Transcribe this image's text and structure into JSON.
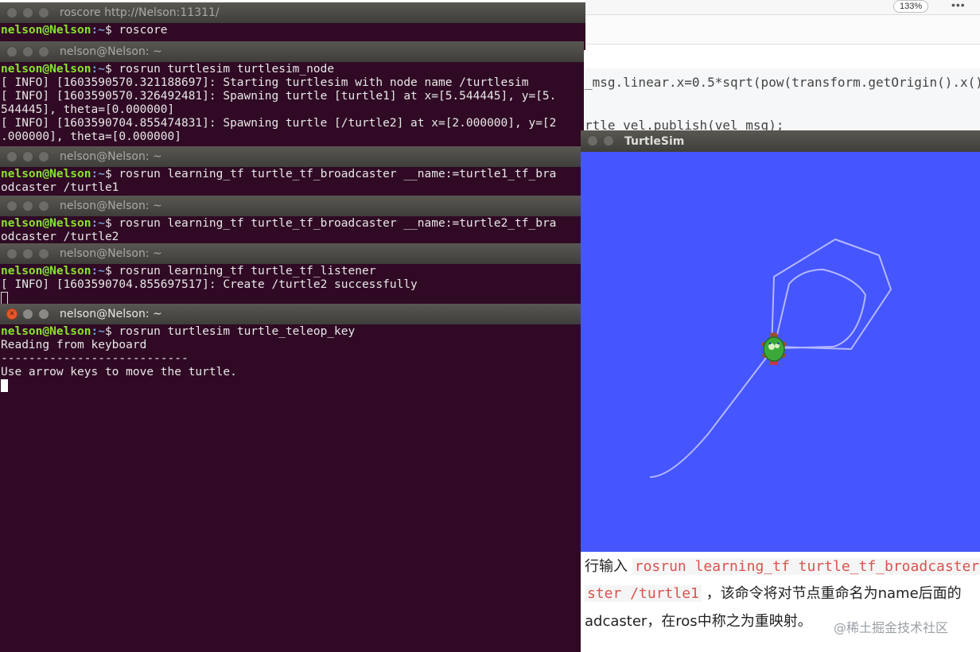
{
  "browser": {
    "zoom": "133%",
    "menu": "•••"
  },
  "code_snippet": {
    "line1": "_msg.linear.x=0.5*sqrt(pow(transform.getOrigin().x()",
    "line2": "rtle_vel.publish(vel_msg);"
  },
  "article": {
    "line1_prefix": "行输入",
    "line1_code": "rosrun learning_tf turtle_tf_broadcaster",
    "line2_code": "ster /turtle1",
    "line2_suffix": "，该命令将对节点重命名为name后面的",
    "line3": "adcaster，在ros中称之为重映射。",
    "watermark": "@稀土掘金技术社区"
  },
  "prompt": {
    "user": "nelson@Nelson",
    "path": ":~",
    "symbol": "$"
  },
  "terminals": [
    {
      "title": "roscore http://Nelson:11311/",
      "lines": [
        {
          "cmd": " roscore"
        }
      ]
    },
    {
      "title": "nelson@Nelson: ~",
      "lines": [
        {
          "cmd": " rosrun turtlesim turtlesim_node"
        },
        {
          "text": "[ INFO] [1603590570.321188697]: Starting turtlesim with node name /turtlesim"
        },
        {
          "text": "[ INFO] [1603590570.326492481]: Spawning turtle [turtle1] at x=[5.544445], y=[5."
        },
        {
          "text": "544445], theta=[0.000000]"
        },
        {
          "text": "[ INFO] [1603590704.855474831]: Spawning turtle [/turtle2] at x=[2.000000], y=[2"
        },
        {
          "text": ".000000], theta=[0.000000]"
        }
      ]
    },
    {
      "title": "nelson@Nelson: ~",
      "lines": [
        {
          "cmd": " rosrun learning_tf turtle_tf_broadcaster __name:=turtle1_tf_bra"
        },
        {
          "text": "odcaster /turtle1"
        }
      ]
    },
    {
      "title": "nelson@Nelson: ~",
      "lines": [
        {
          "cmd": " rosrun learning_tf turtle_tf_broadcaster __name:=turtle2_tf_bra"
        },
        {
          "text": "odcaster /turtle2"
        }
      ]
    },
    {
      "title": "nelson@Nelson: ~",
      "lines": [
        {
          "cmd": " rosrun learning_tf turtle_tf_listener"
        },
        {
          "text": "[ INFO] [1603590704.855697517]: Create /turtle2 successfully"
        }
      ]
    },
    {
      "title": "nelson@Nelson: ~",
      "lines": [
        {
          "cmd": " rosrun turtlesim turtle_teleop_key"
        },
        {
          "text": "Reading from keyboard"
        },
        {
          "text": "---------------------------"
        },
        {
          "text": "Use arrow keys to move the turtle."
        }
      ]
    }
  ],
  "turtlesim": {
    "title": "TurtleSim",
    "background": "#4556ff",
    "pen_color": "#b3b8ff"
  },
  "colors": {
    "terminal_bg": "#300a24",
    "prompt_user": "#8ae234",
    "prompt_path": "#729fcf",
    "close_button": "#e8582d"
  }
}
